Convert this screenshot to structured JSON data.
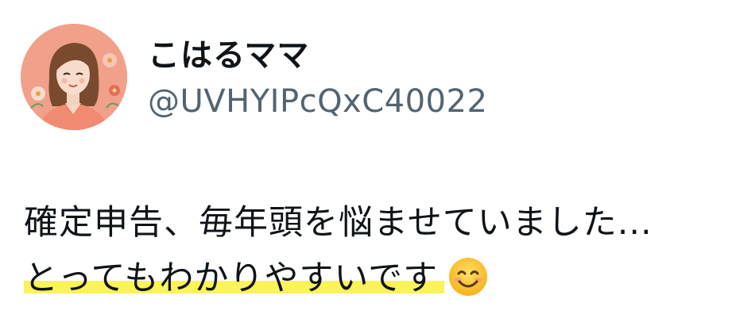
{
  "user": {
    "display_name": "こはるママ",
    "handle": "@UVHYIPcQxC40022",
    "avatar_icon": "woman-portrait-avatar"
  },
  "tweet": {
    "line1": "確定申告、毎年頭を悩ませていました...",
    "line2": "とってもわかりやすいです",
    "emoji": "smiling-face-emoji",
    "highlight_color": "#fbf35a"
  },
  "colors": {
    "text": "#0f1419",
    "handle": "#536471",
    "avatar_bg": "#f1a08a"
  }
}
